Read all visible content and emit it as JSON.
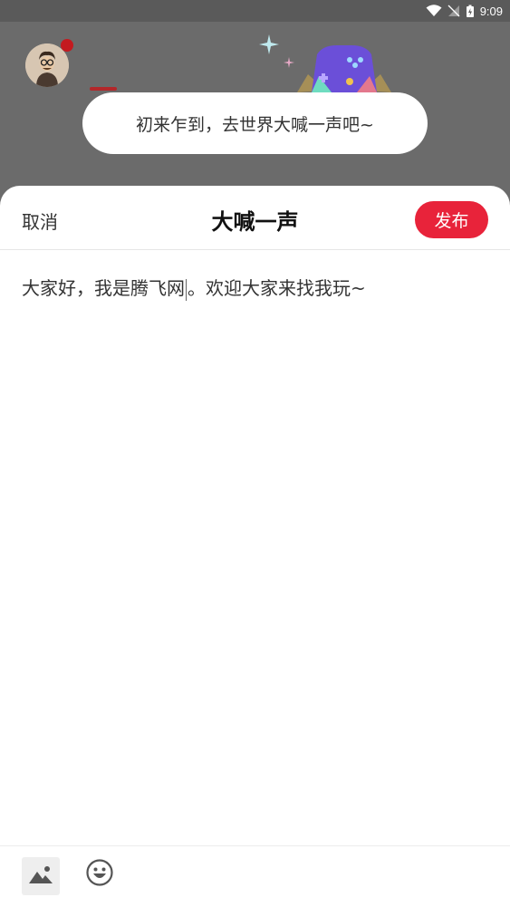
{
  "status_bar": {
    "time": "9:09"
  },
  "tooltip": {
    "text": "初来乍到，去世界大喊一声吧~"
  },
  "sheet": {
    "cancel_label": "取消",
    "title": "大喊一声",
    "publish_label": "发布",
    "content_before_cursor": "大家好，我是腾飞网",
    "content_after_cursor": "。欢迎大家来找我玩~"
  },
  "toolbar": {
    "icons": [
      "image-icon",
      "emoji-icon"
    ]
  },
  "colors": {
    "accent": "#e8233a",
    "overlay": "#686868",
    "gamepad": "#7b53f2"
  }
}
